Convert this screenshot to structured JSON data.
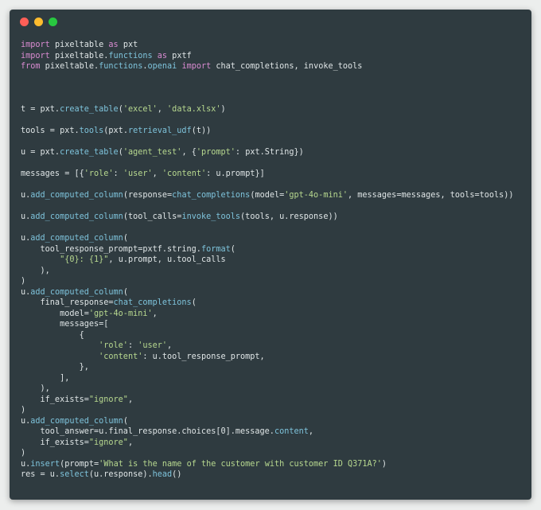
{
  "colors": {
    "background": "#eceeed",
    "window": "#2f3b40",
    "text": "#dfe5e6",
    "keyword": "#d98bd1",
    "function": "#7ec3db",
    "string": "#b7d88f",
    "dot_red": "#ff5f57",
    "dot_yellow": "#febc2e",
    "dot_green": "#28c840"
  },
  "window_controls": [
    "close",
    "minimize",
    "zoom"
  ],
  "code_lines": [
    [
      [
        "kw",
        "import"
      ],
      [
        "txt",
        " pixeltable "
      ],
      [
        "kw",
        "as"
      ],
      [
        "txt",
        " pxt"
      ]
    ],
    [
      [
        "kw",
        "import"
      ],
      [
        "txt",
        " pixeltable."
      ],
      [
        "fn",
        "functions"
      ],
      [
        "txt",
        " "
      ],
      [
        "kw",
        "as"
      ],
      [
        "txt",
        " pxtf"
      ]
    ],
    [
      [
        "kw",
        "from"
      ],
      [
        "txt",
        " pixeltable."
      ],
      [
        "fn",
        "functions"
      ],
      [
        "txt",
        "."
      ],
      [
        "fn",
        "openai"
      ],
      [
        "txt",
        " "
      ],
      [
        "kw",
        "import"
      ],
      [
        "txt",
        " chat_completions, invoke_tools"
      ]
    ],
    [],
    [],
    [],
    [
      [
        "txt",
        "t = pxt."
      ],
      [
        "fn",
        "create_table"
      ],
      [
        "txt",
        "("
      ],
      [
        "str",
        "'excel'"
      ],
      [
        "txt",
        ", "
      ],
      [
        "str",
        "'data.xlsx'"
      ],
      [
        "txt",
        ")"
      ]
    ],
    [],
    [
      [
        "txt",
        "tools = pxt."
      ],
      [
        "fn",
        "tools"
      ],
      [
        "txt",
        "(pxt."
      ],
      [
        "fn",
        "retrieval_udf"
      ],
      [
        "txt",
        "(t))"
      ]
    ],
    [],
    [
      [
        "txt",
        "u = pxt."
      ],
      [
        "fn",
        "create_table"
      ],
      [
        "txt",
        "("
      ],
      [
        "str",
        "'agent_test'"
      ],
      [
        "txt",
        ", {"
      ],
      [
        "str",
        "'prompt'"
      ],
      [
        "txt",
        ": pxt.String})"
      ]
    ],
    [],
    [
      [
        "txt",
        "messages = [{"
      ],
      [
        "str",
        "'role'"
      ],
      [
        "txt",
        ": "
      ],
      [
        "str",
        "'user'"
      ],
      [
        "txt",
        ", "
      ],
      [
        "str",
        "'content'"
      ],
      [
        "txt",
        ": u.prompt}]"
      ]
    ],
    [],
    [
      [
        "txt",
        "u."
      ],
      [
        "fn",
        "add_computed_column"
      ],
      [
        "txt",
        "(response="
      ],
      [
        "fn",
        "chat_completions"
      ],
      [
        "txt",
        "(model="
      ],
      [
        "str",
        "'gpt-4o-mini'"
      ],
      [
        "txt",
        ", messages=messages, tools=tools))"
      ]
    ],
    [],
    [
      [
        "txt",
        "u."
      ],
      [
        "fn",
        "add_computed_column"
      ],
      [
        "txt",
        "(tool_calls="
      ],
      [
        "fn",
        "invoke_tools"
      ],
      [
        "txt",
        "(tools, u.response))"
      ]
    ],
    [],
    [
      [
        "txt",
        "u."
      ],
      [
        "fn",
        "add_computed_column"
      ],
      [
        "txt",
        "("
      ]
    ],
    [
      [
        "txt",
        "    tool_response_prompt=pxtf.string."
      ],
      [
        "fn",
        "format"
      ],
      [
        "txt",
        "("
      ]
    ],
    [
      [
        "txt",
        "        "
      ],
      [
        "str",
        "\"{0}: {1}\""
      ],
      [
        "txt",
        ", u.prompt, u.tool_calls"
      ]
    ],
    [
      [
        "txt",
        "    ),"
      ]
    ],
    [
      [
        "txt",
        ")"
      ]
    ],
    [
      [
        "txt",
        "u."
      ],
      [
        "fn",
        "add_computed_column"
      ],
      [
        "txt",
        "("
      ]
    ],
    [
      [
        "txt",
        "    final_response="
      ],
      [
        "fn",
        "chat_completions"
      ],
      [
        "txt",
        "("
      ]
    ],
    [
      [
        "txt",
        "        model="
      ],
      [
        "str",
        "'gpt-4o-mini'"
      ],
      [
        "txt",
        ","
      ]
    ],
    [
      [
        "txt",
        "        messages=["
      ]
    ],
    [
      [
        "txt",
        "            {"
      ]
    ],
    [
      [
        "txt",
        "                "
      ],
      [
        "str",
        "'role'"
      ],
      [
        "txt",
        ": "
      ],
      [
        "str",
        "'user'"
      ],
      [
        "txt",
        ","
      ]
    ],
    [
      [
        "txt",
        "                "
      ],
      [
        "str",
        "'content'"
      ],
      [
        "txt",
        ": u.tool_response_prompt,"
      ]
    ],
    [
      [
        "txt",
        "            },"
      ]
    ],
    [
      [
        "txt",
        "        ],"
      ]
    ],
    [
      [
        "txt",
        "    ),"
      ]
    ],
    [
      [
        "txt",
        "    if_exists="
      ],
      [
        "str",
        "\"ignore\""
      ],
      [
        "txt",
        ","
      ]
    ],
    [
      [
        "txt",
        ")"
      ]
    ],
    [
      [
        "txt",
        "u."
      ],
      [
        "fn",
        "add_computed_column"
      ],
      [
        "txt",
        "("
      ]
    ],
    [
      [
        "txt",
        "    tool_answer=u.final_response.choices[0].message."
      ],
      [
        "fn",
        "content"
      ],
      [
        "txt",
        ","
      ]
    ],
    [
      [
        "txt",
        "    if_exists="
      ],
      [
        "str",
        "\"ignore\""
      ],
      [
        "txt",
        ","
      ]
    ],
    [
      [
        "txt",
        ")"
      ]
    ],
    [
      [
        "txt",
        "u."
      ],
      [
        "fn",
        "insert"
      ],
      [
        "txt",
        "(prompt="
      ],
      [
        "str",
        "'What is the name of the customer with customer ID Q371A?'"
      ],
      [
        "txt",
        ")"
      ]
    ],
    [
      [
        "txt",
        "res = u."
      ],
      [
        "fn",
        "select"
      ],
      [
        "txt",
        "(u.response)."
      ],
      [
        "fn",
        "head"
      ],
      [
        "txt",
        "()"
      ]
    ]
  ]
}
